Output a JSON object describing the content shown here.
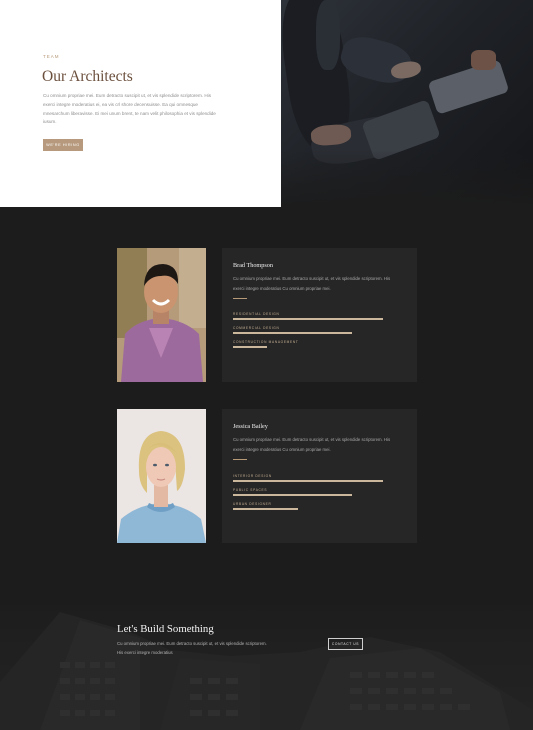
{
  "hero": {
    "eyebrow": "TEAM",
    "title": "Our Architects",
    "description": "Cu omnium propriae mei. Eum detracto suscipit ut, et vis splendide scriptorem. His exerci integre moderatius ei, ea vis crl shore decensuisse. Ea qui omnesque mnesarchum liberavisse. Ei mei unum brent, te nam velit philosophia et vis splendide iusum.",
    "button_label": "WE'RE HIRING"
  },
  "architects": [
    {
      "name": "Brad Thompson",
      "bio": "Cu omnium propriae mei. Eum detracto suscipit ut, et vis splendide scriptorem. His exerci integre moderatius Cu omnium propriae mei.",
      "skills": [
        {
          "label": "RESIDENTIAL DESIGN",
          "level": 0.88
        },
        {
          "label": "COMMERCIAL DESIGN",
          "level": 0.7
        },
        {
          "label": "CONSTRUCTION MANAGEMENT",
          "level": 0.2
        }
      ]
    },
    {
      "name": "Jessica Bailey",
      "bio": "Cu omnium propriae mei. Eum detracto suscipit ut, et vis splendide scriptorem. His exerci integre moderatius Cu omnium propriae mei.",
      "skills": [
        {
          "label": "INTERIOR DESIGN",
          "level": 0.88
        },
        {
          "label": "PUBLIC SPACES",
          "level": 0.7
        },
        {
          "label": "URBAN DESIGNER",
          "level": 0.38
        }
      ]
    }
  ],
  "cta": {
    "title": "Let's Build Something",
    "description": "Cu omnium propriae mei. Eum detracto suscipit ut, et vis splendide scriptorem. His exerci integre moderatius",
    "button_label": "CONTACT US"
  },
  "colors": {
    "accent": "#b79a78",
    "dark_bg": "#1c1c1c",
    "card_bg": "#262626",
    "title_brown": "#6b4f3d"
  }
}
